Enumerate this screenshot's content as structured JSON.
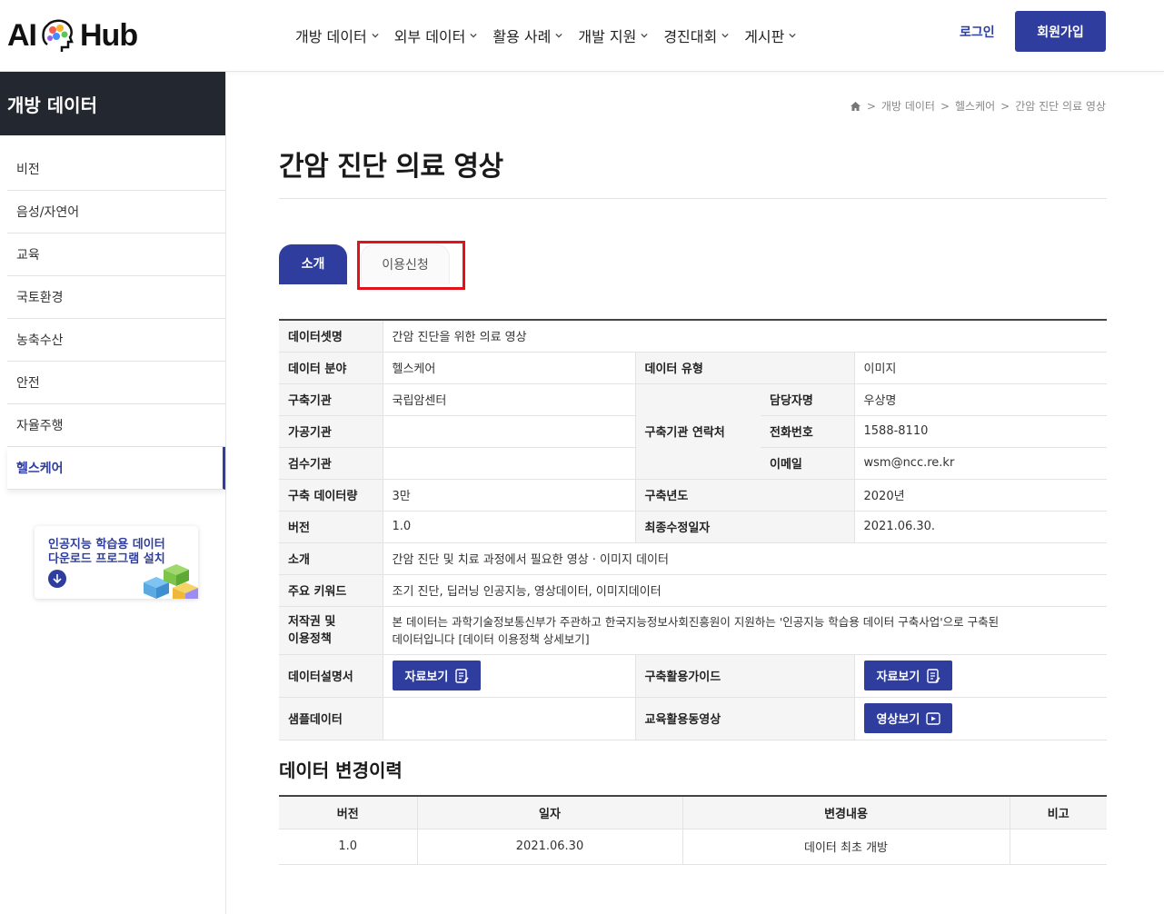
{
  "header": {
    "logo_left": "AI",
    "logo_right": "Hub",
    "nav": [
      "개방 데이터",
      "외부 데이터",
      "활용 사례",
      "개발 지원",
      "경진대회",
      "게시판"
    ],
    "login": "로그인",
    "signup": "회원가입",
    "accent": "#2f3e9e"
  },
  "sidebar": {
    "title": "개방 데이터",
    "items": [
      {
        "label": "비전",
        "active": false
      },
      {
        "label": "음성/자연어",
        "active": false
      },
      {
        "label": "교육",
        "active": false
      },
      {
        "label": "국토환경",
        "active": false
      },
      {
        "label": "농축수산",
        "active": false
      },
      {
        "label": "안전",
        "active": false
      },
      {
        "label": "자율주행",
        "active": false
      },
      {
        "label": "헬스케어",
        "active": true
      }
    ],
    "promo": {
      "line1": "인공지능 학습용 데이터",
      "line2": "다운로드 프로그램 설치",
      "icon": "download-icon"
    }
  },
  "breadcrumb": [
    "개방 데이터",
    "헬스케어",
    "간암 진단 의료 영상"
  ],
  "page_title": "간암 진단 의료 영상",
  "tabs": {
    "active": "소개",
    "other": "이용신청"
  },
  "info": {
    "dataset_label": "데이터셋명",
    "dataset_value": "간암 진단을 위한 의료 영상",
    "field_label": "데이터 분야",
    "field_value": "헬스케어",
    "type_label": "데이터 유형",
    "type_value": "이미지",
    "org_label": "구축기관",
    "org_value": "국립암센터",
    "contact_label": "구축기관 연락처",
    "manager_label": "담당자명",
    "manager_value": "우상명",
    "process_label": "가공기관",
    "process_value": "",
    "phone_label": "전화번호",
    "phone_value": "1588-8110",
    "inspect_label": "검수기관",
    "inspect_value": "",
    "email_label": "이메일",
    "email_value": "wsm@ncc.re.kr",
    "amount_label": "구축 데이터량",
    "amount_value": "3만",
    "year_label": "구축년도",
    "year_value": "2020년",
    "version_label": "버전",
    "version_value": "1.0",
    "modified_label": "최종수정일자",
    "modified_value": "2021.06.30.",
    "intro_label": "소개",
    "intro_value": "간암 진단 및 치료 과정에서 필요한 영상 · 이미지 데이터",
    "keyword_label": "주요 키워드",
    "keyword_value": "조기 진단, 딥러닝 인공지능, 영상데이터, 이미지데이터",
    "copyright_label_1": "저작권 및",
    "copyright_label_2": "이용정책",
    "copyright_line1": "본 데이터는 과학기술정보통신부가 주관하고 한국지능정보사회진흥원이 지원하는 '인공지능 학습용 데이터 구축사업'으로 구축된",
    "copyright_line2": "데이터입니다 [데이터 이용정책 상세보기]",
    "spec_label": "데이터설명서",
    "spec_button": "자료보기",
    "guide_label": "구축활용가이드",
    "guide_button": "자료보기",
    "sample_label": "샘플데이터",
    "sample_value": "",
    "edu_label": "교육활용동영상",
    "edu_button": "영상보기"
  },
  "history": {
    "title": "데이터 변경이력",
    "columns": [
      "버전",
      "일자",
      "변경내용",
      "비고"
    ],
    "rows": [
      [
        "1.0",
        "2021.06.30",
        "데이터 최초 개방",
        ""
      ]
    ]
  }
}
